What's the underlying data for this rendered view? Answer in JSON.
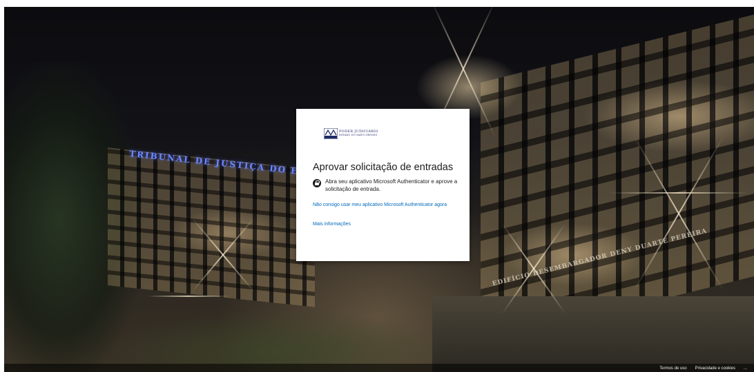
{
  "background": {
    "sign_text": "TRIBUNAL DE JUSTIÇA DO ESTADO",
    "building_sign": "EDIFÍCIO DESEMBARGADOR DENY DUARTE PEREIRA"
  },
  "card": {
    "logo": {
      "line1": "PODER JUDICIÁRIO",
      "line2": "ESTADO DO MATO GROSSO"
    },
    "title": "Aprovar solicitação de entradas",
    "message": "Abra seu aplicativo Microsoft Authenticator e aprove a solicitação de entrada.",
    "link_cannot_use": "Não consigo usar meu aplicativo Microsoft Authenticator agora",
    "link_more_info": "Mais informações"
  },
  "footer": {
    "terms": "Termos de uso",
    "privacy": "Privacidade e cookies",
    "more": "..."
  },
  "colors": {
    "link": "#0067b8",
    "title": "#1b1b1b",
    "sign": "#6f86ff"
  }
}
